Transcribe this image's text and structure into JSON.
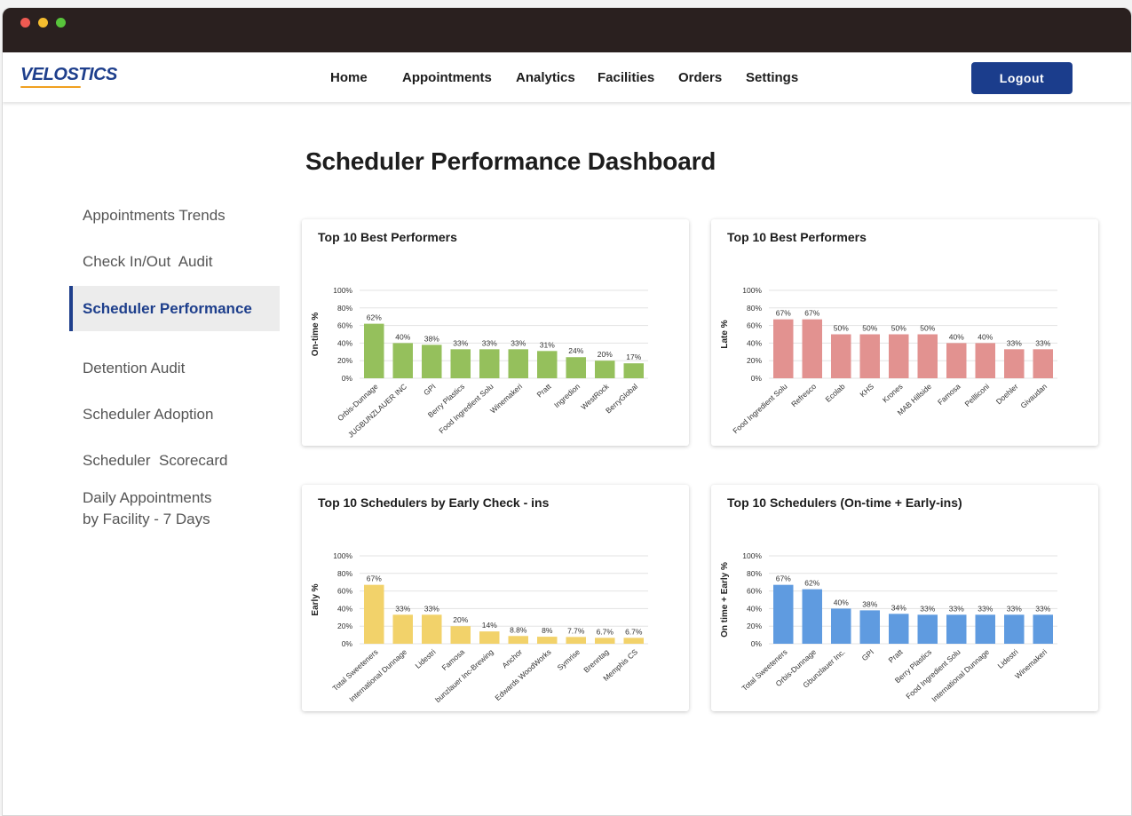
{
  "brand": {
    "logo": "VELOSTICS",
    "accent": "#1e3f8c",
    "underline": "#f0a020"
  },
  "nav": {
    "items": [
      "Home",
      "Appointments",
      "Analytics",
      "Facilities",
      "Orders",
      "Settings"
    ],
    "logout": "Logout"
  },
  "page": {
    "title": "Scheduler Performance Dashboard"
  },
  "sidebar": {
    "items": [
      {
        "label": "Appointments Trends"
      },
      {
        "label": "Check In/Out  Audit"
      },
      {
        "label": "Scheduler Performance",
        "active": true
      },
      {
        "label": "Detention Audit"
      },
      {
        "label": "Scheduler Adoption"
      },
      {
        "label": "Scheduler  Scorecard"
      },
      {
        "label": "Daily Appointments\nby Facility - 7 Days"
      }
    ]
  },
  "chart_data": [
    {
      "type": "bar",
      "title": "Top 10 Best Performers",
      "ylabel": "On-time %",
      "ylim": [
        0,
        100
      ],
      "yticks": [
        "0%",
        "20%",
        "40%",
        "60%",
        "80%",
        "100%"
      ],
      "categories": [
        "Orbis-Dunnage",
        "JUGBUNZLAUER INC",
        "GPI",
        "Berry Plastics",
        "Food Ingredient Solu",
        "Winemakeri",
        "Pratt",
        "Ingredion",
        "WestRock",
        "BerryGlobal"
      ],
      "values": [
        62,
        40,
        38,
        33,
        33,
        33,
        31,
        24,
        20,
        17
      ],
      "labels": [
        "62%",
        "40%",
        "38%",
        "33%",
        "33%",
        "33%",
        "31%",
        "24%",
        "20%",
        "17%"
      ],
      "color": "#95c05c",
      "grid": true
    },
    {
      "type": "bar",
      "title": "Top 10 Best Performers",
      "ylabel": "Late %",
      "ylim": [
        0,
        100
      ],
      "yticks": [
        "0%",
        "20%",
        "40%",
        "60%",
        "80%",
        "100%"
      ],
      "categories": [
        "Food Ingredient Solu",
        "Refresco",
        "Ecolab",
        "KHS",
        "Krones",
        "MAB Hillside",
        "Famosa",
        "Pellliconi",
        "Doehler",
        "Givaudan"
      ],
      "values": [
        67,
        67,
        50,
        50,
        50,
        50,
        40,
        40,
        33,
        33
      ],
      "labels": [
        "67%",
        "67%",
        "50%",
        "50%",
        "50%",
        "50%",
        "40%",
        "40%",
        "33%",
        "33%"
      ],
      "color": "#e29290",
      "grid": true
    },
    {
      "type": "bar",
      "title": "Top 10 Schedulers by Early Check - ins",
      "ylabel": "Early %",
      "ylim": [
        0,
        100
      ],
      "yticks": [
        "0%",
        "20%",
        "40%",
        "60%",
        "80%",
        "100%"
      ],
      "categories": [
        "Total Sweeteners",
        "International Dunnage",
        "Lidestri",
        "Famosa",
        "bunzlauer Inc-Brewing",
        "Anchor",
        "Edwards WoodWorks",
        "Symrise",
        "Brenntag",
        "Memphis CS"
      ],
      "values": [
        67,
        33,
        33,
        20,
        14,
        8.8,
        8,
        7.7,
        6.7,
        6.7
      ],
      "labels": [
        "67%",
        "33%",
        "33%",
        "20%",
        "14%",
        "8.8%",
        "8%",
        "7.7%",
        "6.7%",
        "6.7%"
      ],
      "color": "#f2d26a",
      "grid": true
    },
    {
      "type": "bar",
      "title": "Top 10 Schedulers (On-time + Early-ins)",
      "ylabel": "On time + Early %",
      "ylim": [
        0,
        100
      ],
      "yticks": [
        "0%",
        "20%",
        "40%",
        "60%",
        "80%",
        "100%"
      ],
      "categories": [
        "Total Sweeteners",
        "Orbis-Dunnage",
        "Gbunzlauer Inc.",
        "GPI",
        "Pratt",
        "Berry Plastics",
        "Food Ingredient Solu",
        "International Dunnage",
        "Lidestri",
        "Winemakeri"
      ],
      "values": [
        67,
        62,
        40,
        38,
        34,
        33,
        33,
        33,
        33,
        33
      ],
      "labels": [
        "67%",
        "62%",
        "40%",
        "38%",
        "34%",
        "33%",
        "33%",
        "33%",
        "33%",
        "33%"
      ],
      "color": "#5f9be0",
      "grid": true
    }
  ]
}
